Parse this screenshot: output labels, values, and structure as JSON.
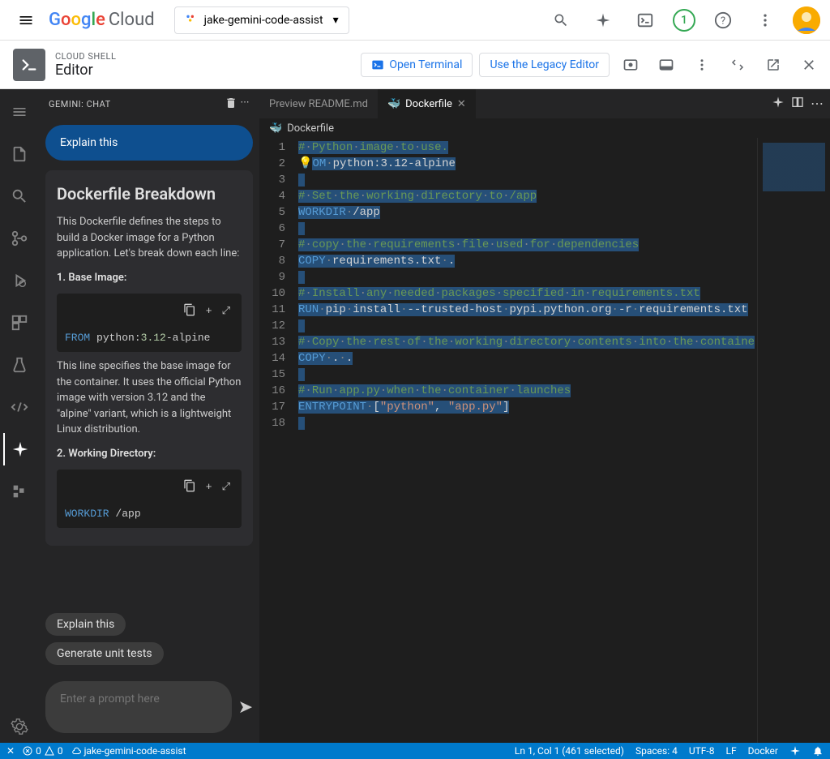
{
  "header": {
    "logo_google": "Google",
    "logo_cloud": "Cloud",
    "project_name": "jake-gemini-code-assist",
    "badge_count": "1"
  },
  "shell": {
    "title_small": "CLOUD SHELL",
    "title_main": "Editor",
    "open_terminal": "Open Terminal",
    "legacy_editor": "Use the Legacy Editor"
  },
  "chat": {
    "header": "GEMINI: CHAT",
    "user_prompt": "Explain this",
    "response_title": "Dockerfile Breakdown",
    "response_intro": "This Dockerfile defines the steps to build a Docker image for a Python application. Let's break down each line:",
    "section1_title": "1. Base Image:",
    "code1_from": "FROM",
    "code1_rest": " python:",
    "code1_ver": "3.12",
    "code1_suffix": "-alpine",
    "section1_body": "This line specifies the base image for the container. It uses the official Python image with version 3.12 and the \"alpine\" variant, which is a lightweight Linux distribution.",
    "section2_title": "2. Working Directory:",
    "code2_kw": "WORKDIR",
    "code2_path": " /app",
    "suggestions": [
      "Explain this",
      "Generate unit tests"
    ],
    "prompt_placeholder": "Enter a prompt here"
  },
  "tabs": {
    "tab1": "Preview README.md",
    "tab2": "Dockerfile"
  },
  "breadcrumb": {
    "file": "Dockerfile"
  },
  "code": {
    "lines": [
      {
        "n": 1,
        "type": "comment",
        "text": "# Python image to use."
      },
      {
        "n": 2,
        "type": "from",
        "kw": "OM",
        "rest": " python:3.12-alpine"
      },
      {
        "n": 3,
        "type": "empty",
        "text": ""
      },
      {
        "n": 4,
        "type": "comment",
        "text": "# Set the working directory to /app"
      },
      {
        "n": 5,
        "type": "workdir",
        "kw": "WORKDIR",
        "rest": " /app"
      },
      {
        "n": 6,
        "type": "empty",
        "text": ""
      },
      {
        "n": 7,
        "type": "comment",
        "text": "# copy the requirements file used for dependencies"
      },
      {
        "n": 8,
        "type": "copy",
        "kw": "COPY",
        "rest": " requirements.txt ."
      },
      {
        "n": 9,
        "type": "empty",
        "text": ""
      },
      {
        "n": 10,
        "type": "comment",
        "text": "# Install any needed packages specified in requirements.txt"
      },
      {
        "n": 11,
        "type": "run",
        "kw": "RUN",
        "rest": " pip install --trusted-host pypi.python.org -r requirements.txt"
      },
      {
        "n": 12,
        "type": "empty",
        "text": ""
      },
      {
        "n": 13,
        "type": "comment",
        "text": "# Copy the rest of the working directory contents into the containe"
      },
      {
        "n": 14,
        "type": "copy",
        "kw": "COPY",
        "rest": " . ."
      },
      {
        "n": 15,
        "type": "empty",
        "text": ""
      },
      {
        "n": 16,
        "type": "comment",
        "text": "# Run app.py when the container launches"
      },
      {
        "n": 17,
        "type": "entrypoint",
        "kw": "ENTRYPOINT",
        "rest_open": " [",
        "str1": "\"python\"",
        "comma": ", ",
        "str2": "\"app.py\"",
        "close": "]"
      },
      {
        "n": 18,
        "type": "empty",
        "text": ""
      }
    ]
  },
  "status": {
    "errors": "0",
    "warnings": "0",
    "project": "jake-gemini-code-assist",
    "cursor": "Ln 1, Col 1 (461 selected)",
    "spaces": "Spaces: 4",
    "encoding": "UTF-8",
    "eol": "LF",
    "lang": "Docker"
  }
}
